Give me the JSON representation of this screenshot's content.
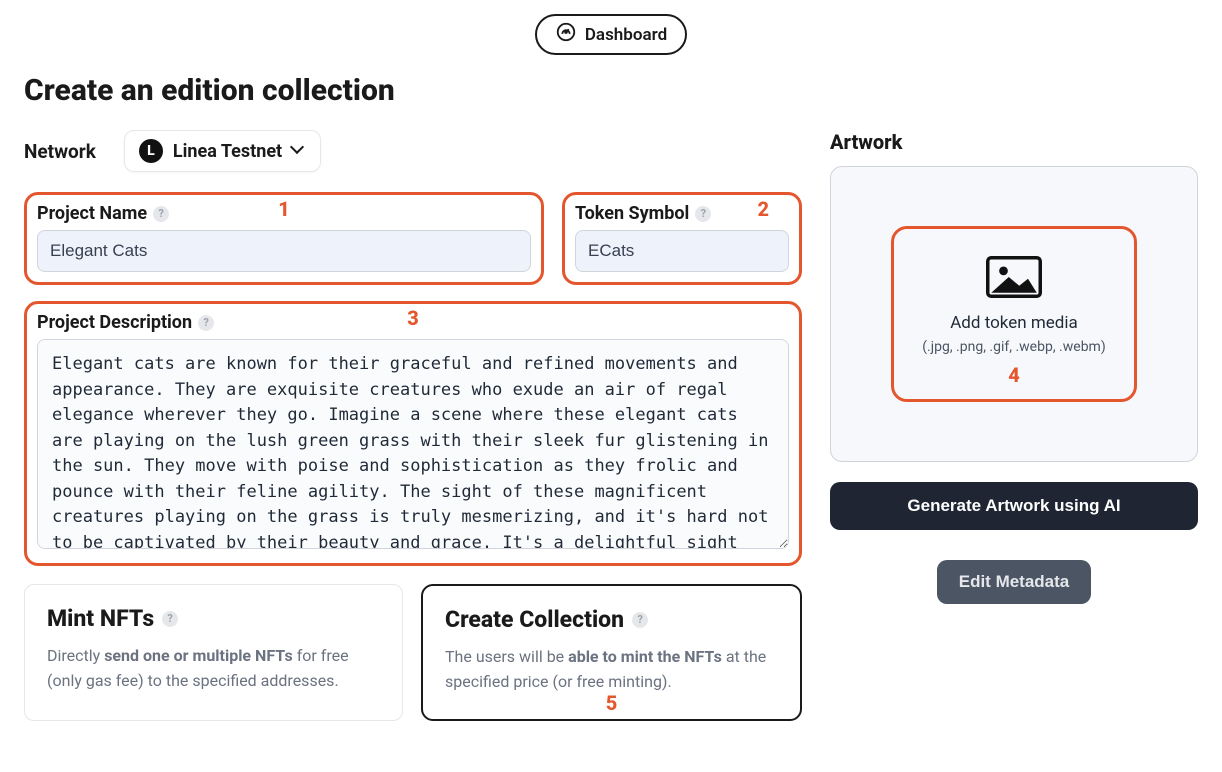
{
  "nav": {
    "dashboard_label": "Dashboard"
  },
  "page": {
    "title": "Create an edition collection"
  },
  "network": {
    "field_label": "Network",
    "selected": "Linea Testnet",
    "badge_letter": "L"
  },
  "fields": {
    "project_name": {
      "label": "Project Name",
      "value": "Elegant Cats"
    },
    "token_symbol": {
      "label": "Token Symbol",
      "value": "ECats"
    },
    "description": {
      "label": "Project Description",
      "value": "Elegant cats are known for their graceful and refined movements and appearance. They are exquisite creatures who exude an air of regal elegance wherever they go. Imagine a scene where these elegant cats are playing on the lush green grass with their sleek fur glistening in the sun. They move with poise and sophistication as they frolic and pounce with their feline agility. The sight of these magnificent creatures playing on the grass is truly mesmerizing, and it's hard not to be captivated by their beauty and grace. It's a delightful sight that leaves you in awe of these magnificent cats."
    }
  },
  "cards": {
    "mint": {
      "title": "Mint NFTs",
      "body_prefix": "Directly ",
      "body_bold": "send one or multiple NFTs",
      "body_suffix": " for free (only gas fee) to the specified addresses."
    },
    "create": {
      "title": "Create Collection",
      "body_prefix": "The users will be ",
      "body_bold": "able to mint the NFTs",
      "body_suffix": " at the specified price (or free minting)."
    }
  },
  "artwork": {
    "section_title": "Artwork",
    "add_title": "Add token media",
    "add_sub": "(.jpg, .png, .gif, .webp, .webm)",
    "generate_btn": "Generate Artwork using AI",
    "edit_btn": "Edit Metadata"
  },
  "annotations": {
    "n1": "1",
    "n2": "2",
    "n3": "3",
    "n4": "4",
    "n5": "5"
  },
  "help_glyph": "?"
}
